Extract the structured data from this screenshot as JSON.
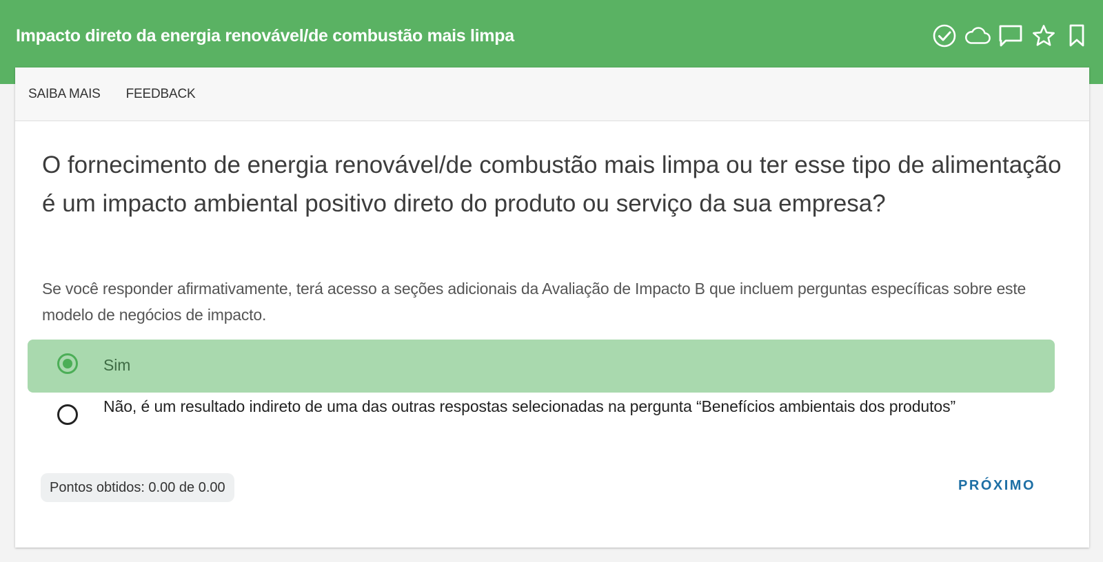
{
  "header": {
    "title": "Impacto direto da energia renovável/de combustão mais limpa",
    "icons": [
      "check-circle-icon",
      "cloud-icon",
      "comment-icon",
      "star-icon",
      "bookmark-icon"
    ],
    "background_color": "#5ab263"
  },
  "tabs": [
    {
      "label": "SAIBA MAIS"
    },
    {
      "label": "FEEDBACK"
    }
  ],
  "question": {
    "text": "O fornecimento de energia renovável/de combustão mais limpa ou ter esse tipo de alimentação é um impacto ambiental positivo direto do produto ou serviço da sua empresa?",
    "description": "Se você responder afirmativamente, terá acesso a seções adicionais da Avaliação de Impacto B que incluem perguntas específicas sobre este modelo de negócios de impacto."
  },
  "options": [
    {
      "label": "Sim",
      "selected": true
    },
    {
      "label": "Não, é um resultado indireto de uma das outras respostas selecionadas na pergunta “Benefícios ambientais dos produtos”",
      "selected": false
    }
  ],
  "footer": {
    "points_label": "Pontos obtidos: 0.00 de 0.00",
    "next_label": "PRÓXIMO"
  },
  "colors": {
    "selected_option_bg": "#a9d9ae",
    "radio_selected": "#4cae57",
    "next_link": "#1d6fa5"
  }
}
